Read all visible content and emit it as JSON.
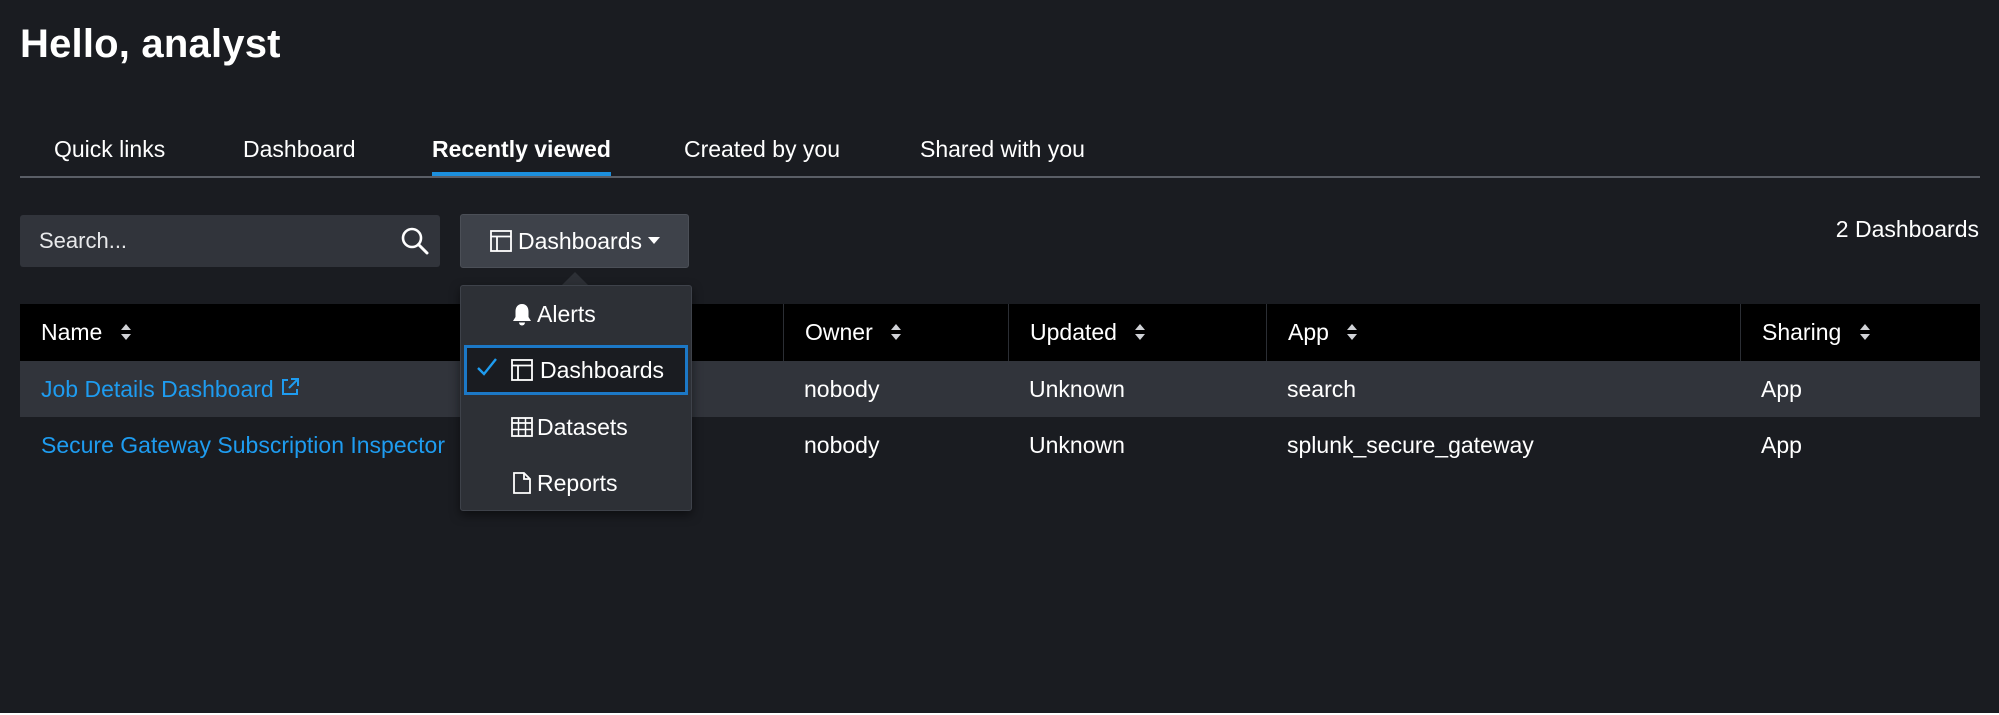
{
  "greeting": "Hello, analyst",
  "tabs": [
    {
      "label": "Quick links"
    },
    {
      "label": "Dashboard"
    },
    {
      "label": "Recently viewed",
      "active": true
    },
    {
      "label": "Created by you"
    },
    {
      "label": "Shared with you"
    }
  ],
  "search": {
    "placeholder": "Search..."
  },
  "type_selector": {
    "label": "Dashboards"
  },
  "result_count": "2 Dashboards",
  "colors": {
    "accent": "#1c8fdd",
    "link": "#1e9cf0",
    "background": "#1a1c21"
  },
  "table": {
    "columns": [
      "Name",
      "Owner",
      "Updated",
      "App",
      "Sharing"
    ],
    "rows": [
      {
        "name": "Job Details Dashboard",
        "owner": "nobody",
        "updated": "Unknown",
        "app": "search",
        "sharing": "App"
      },
      {
        "name": "Secure Gateway Subscription Inspector",
        "owner": "nobody",
        "updated": "Unknown",
        "app": "splunk_secure_gateway",
        "sharing": "App"
      }
    ]
  },
  "menu": {
    "items": [
      {
        "label": "Alerts",
        "icon": "bell-icon"
      },
      {
        "label": "Dashboards",
        "icon": "dashboard-icon",
        "selected": true
      },
      {
        "label": "Datasets",
        "icon": "table-icon"
      },
      {
        "label": "Reports",
        "icon": "document-icon"
      }
    ]
  }
}
